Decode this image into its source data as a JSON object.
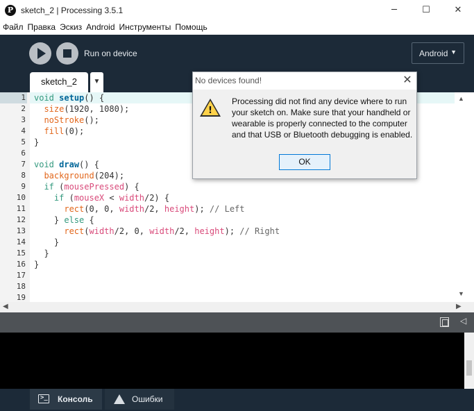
{
  "window": {
    "title": "sketch_2 | Processing 3.5.1",
    "app_icon_glyph": "P",
    "minimize": "─",
    "maximize": "☐",
    "close": "✕"
  },
  "menu": [
    "Файл",
    "Правка",
    "Эскиз",
    "Android",
    "Инструменты",
    "Помощь"
  ],
  "toolbar": {
    "run_label": "Run on device",
    "mode": "Android",
    "mode_chevron": "▼"
  },
  "tabs": {
    "active": "sketch_2",
    "menu_arrow": "▼"
  },
  "editor": {
    "line_numbers": [
      "1",
      "2",
      "3",
      "4",
      "5",
      "6",
      "7",
      "8",
      "9",
      "10",
      "11",
      "12",
      "13",
      "14",
      "15",
      "16",
      "17",
      "18",
      "19"
    ],
    "active_line": 1
  },
  "dialog": {
    "title": "No devices found!",
    "close": "✕",
    "warning_mark": "!",
    "message": "Processing did not find any device where to run your sketch on. Make sure that your handheld or wearable is properly connected to the computer and that USB or Bluetooth debugging is enabled.",
    "ok_label": "OK"
  },
  "scroll": {
    "up": "▲",
    "down": "▼",
    "left": "◀",
    "right": "▶"
  },
  "console": {
    "collapse": "◁",
    "console_icon_glyph": ">_"
  },
  "bottom_tabs": {
    "console": "Консоль",
    "errors": "Ошибки"
  },
  "colors": {
    "toolbar_bg": "#1c2a38",
    "keyword": "#33997e",
    "function": "#006699",
    "builtin": "#e2661a",
    "constant": "#d94a7a",
    "comment": "#666666",
    "ok_border": "#0078d7"
  }
}
